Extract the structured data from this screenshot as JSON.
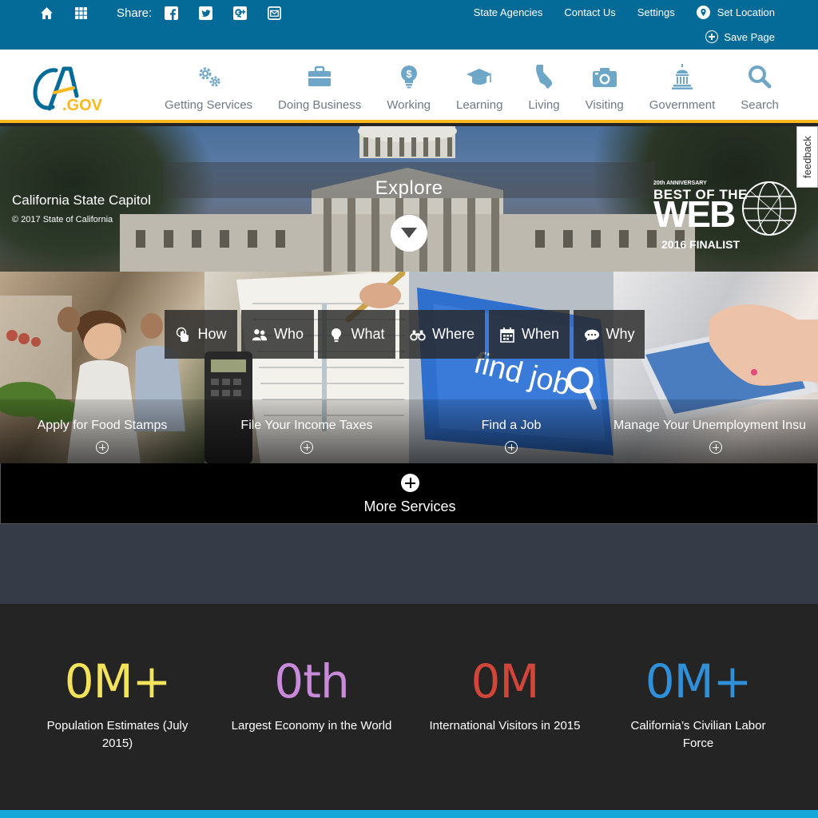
{
  "utility": {
    "share_label": "Share:",
    "links": [
      "State Agencies",
      "Contact Us",
      "Settings"
    ],
    "set_location": "Set Location",
    "save_page": "Save Page"
  },
  "logo": {
    "text_ca": "CA",
    "text_gov": ".GOV"
  },
  "nav": [
    {
      "label": "Getting Services",
      "icon": "gears-icon"
    },
    {
      "label": "Doing Business",
      "icon": "briefcase-icon"
    },
    {
      "label": "Working",
      "icon": "lightbulb-dollar-icon"
    },
    {
      "label": "Learning",
      "icon": "graduation-cap-icon"
    },
    {
      "label": "Living",
      "icon": "california-map-icon"
    },
    {
      "label": "Visiting",
      "icon": "camera-icon"
    },
    {
      "label": "Government",
      "icon": "capitol-icon"
    },
    {
      "label": "Search",
      "icon": "search-icon"
    }
  ],
  "hero": {
    "explore": "Explore",
    "caption_title": "California State Capitol",
    "caption_copy": "© 2017 State of California",
    "feedback": "feedback",
    "award": {
      "anniversary": "20th ANNIVERSARY",
      "best": "BEST OF THE",
      "web": "WEB",
      "finalist": "2016 FINALIST"
    }
  },
  "tiles": [
    {
      "label": "Apply for Food Stamps"
    },
    {
      "label": "File Your Income Taxes"
    },
    {
      "label": "Find a Job",
      "image_text": "find job"
    },
    {
      "label": "Manage Your Unemployment Insu"
    }
  ],
  "filters": [
    "How",
    "Who",
    "What",
    "Where",
    "When",
    "Why"
  ],
  "more_services": "More Services",
  "stats": [
    {
      "value": "0M+",
      "label": "Population Estimates (July 2015)",
      "color": "#f2e35a"
    },
    {
      "value": "0th",
      "label": "Largest Economy in the World",
      "color": "#c98ad9"
    },
    {
      "value": "0M",
      "label": "International Visitors in 2015",
      "color": "#d2463a"
    },
    {
      "value": "0M+",
      "label": "California’s Civilian Labor Force",
      "color": "#2f8fd8"
    }
  ],
  "colors": {
    "utility_bar": "#046b99",
    "nav_accent": "#fdb81e",
    "footer_line": "#14a7d8"
  }
}
